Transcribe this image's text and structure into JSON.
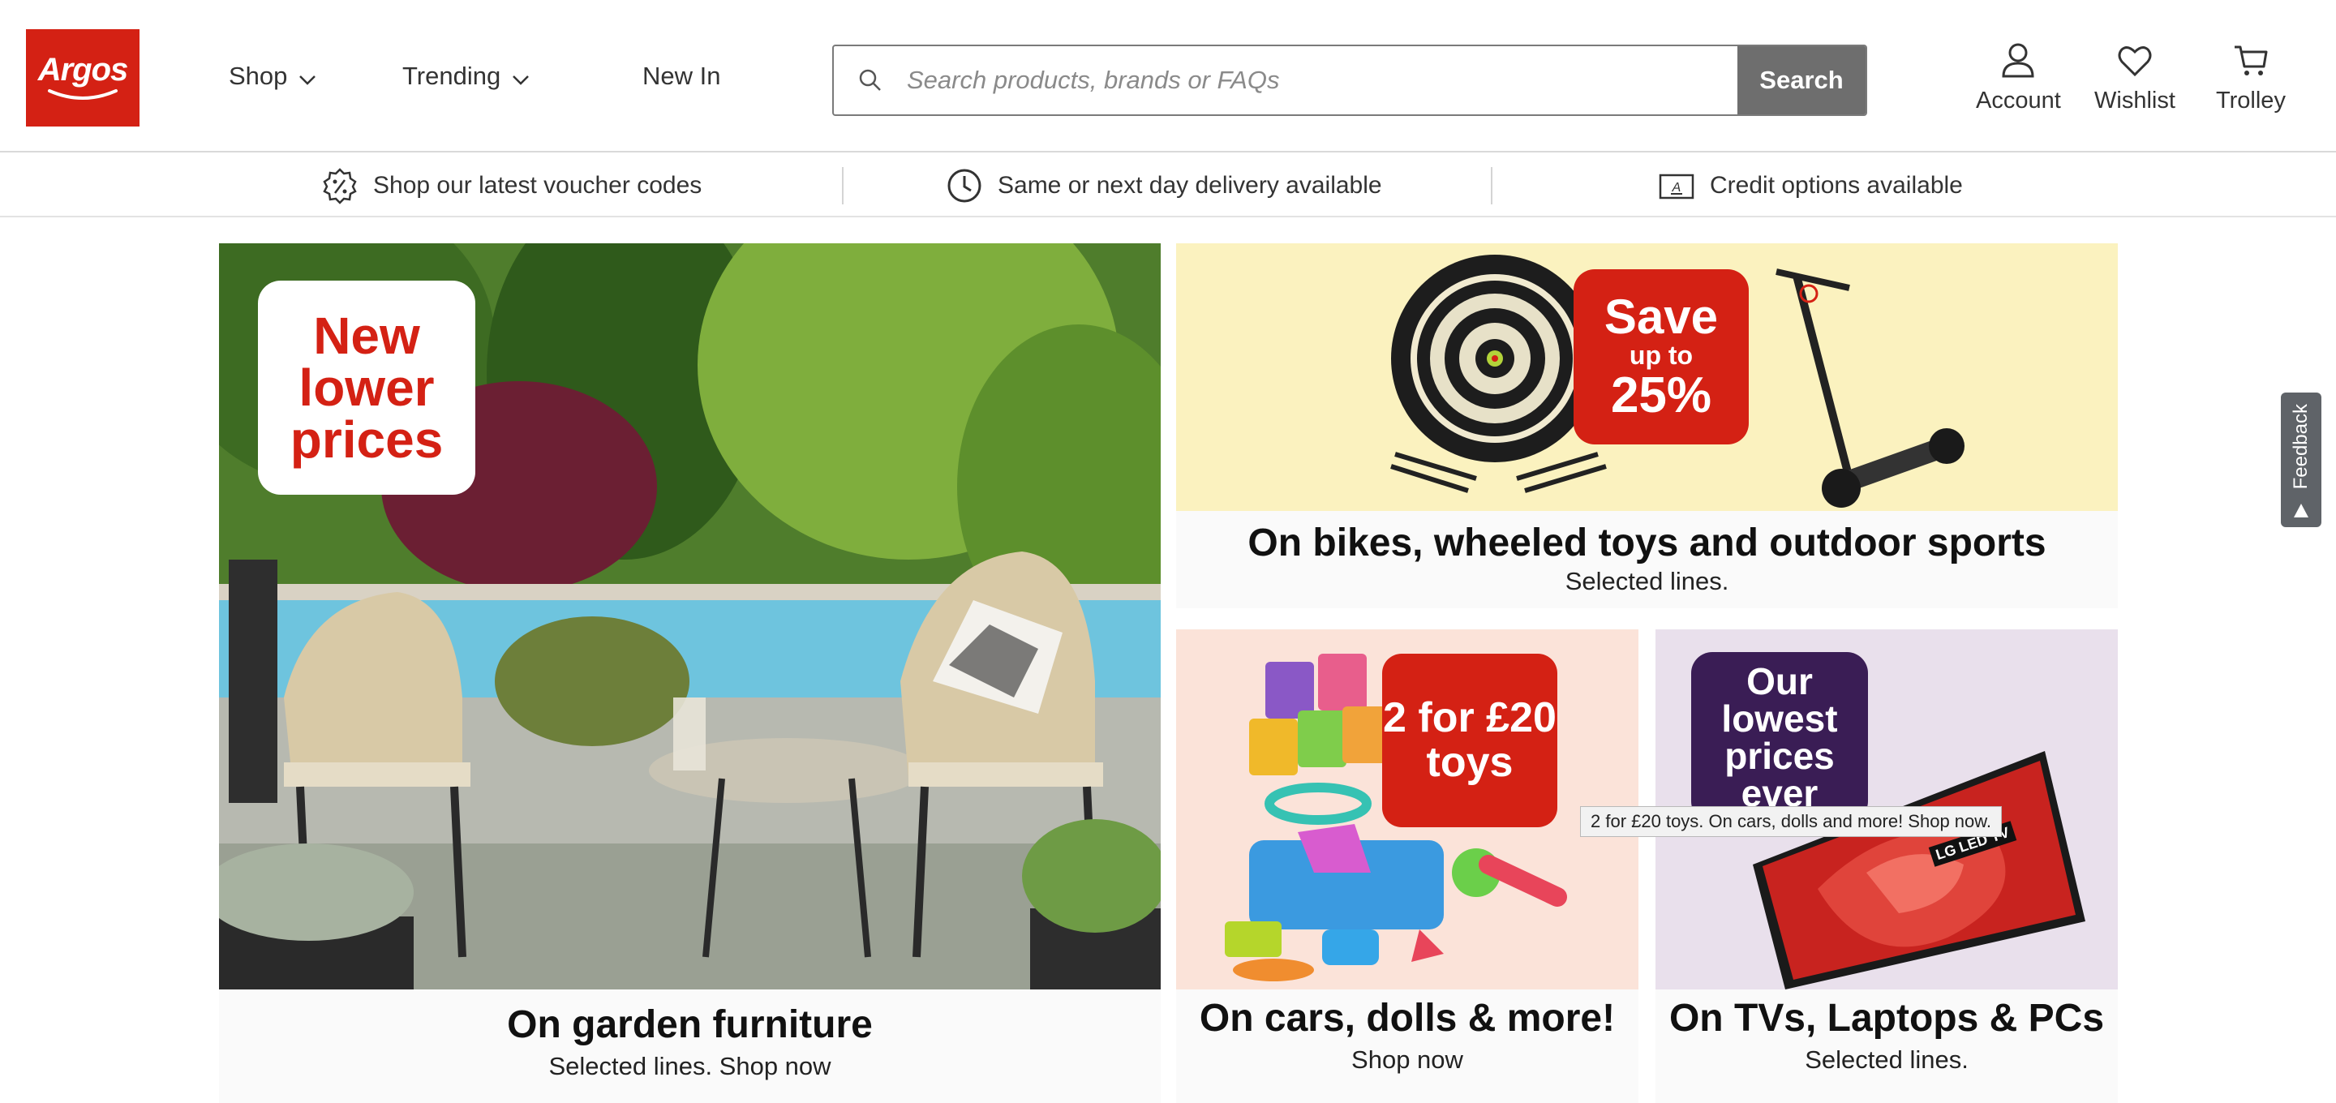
{
  "header": {
    "logo_text": "Argos",
    "nav": [
      {
        "label": "Shop"
      },
      {
        "label": "Trending"
      },
      {
        "label": "New In"
      }
    ],
    "search": {
      "placeholder": "Search products, brands or FAQs",
      "value": "",
      "button_label": "Search"
    },
    "icons": [
      {
        "label": "Account",
        "icon": "account-icon"
      },
      {
        "label": "Wishlist",
        "icon": "heart-icon"
      },
      {
        "label": "Trolley",
        "icon": "trolley-icon"
      }
    ]
  },
  "info_strip": [
    {
      "label": "Shop our latest voucher codes",
      "icon": "voucher-badge-icon"
    },
    {
      "label": "Same or next day delivery available",
      "icon": "clock-icon"
    },
    {
      "label": "Credit options available",
      "icon": "card-icon"
    }
  ],
  "tiles": {
    "garden": {
      "badge": "New lower prices",
      "title": "On garden furniture",
      "subtitle": "Selected lines. Shop now"
    },
    "bikes": {
      "badge_top": "Save",
      "badge_mid": "up to",
      "badge_value": "25%",
      "title": "On bikes, wheeled toys and outdoor sports",
      "subtitle": "Selected lines."
    },
    "toys": {
      "badge": "2 for £20 toys",
      "title": "On cars, dolls & more!",
      "subtitle": "Shop now"
    },
    "tvs": {
      "badge": "Our lowest prices ever",
      "tv_label": "LG LED TV",
      "title": "On TVs, Laptops & PCs",
      "subtitle": "Selected lines."
    }
  },
  "tooltip": "2 for £20 toys. On cars, dolls and more! Shop now.",
  "feedback_label": "Feedback",
  "colors": {
    "brand_red": "#d42114",
    "search_button": "#6e6e6e",
    "bikes_bg": "#fbf2bf",
    "toys_bg": "#fbe3d9",
    "tvs_bg": "#e9e0ec",
    "tv_badge": "#3a1d55"
  }
}
